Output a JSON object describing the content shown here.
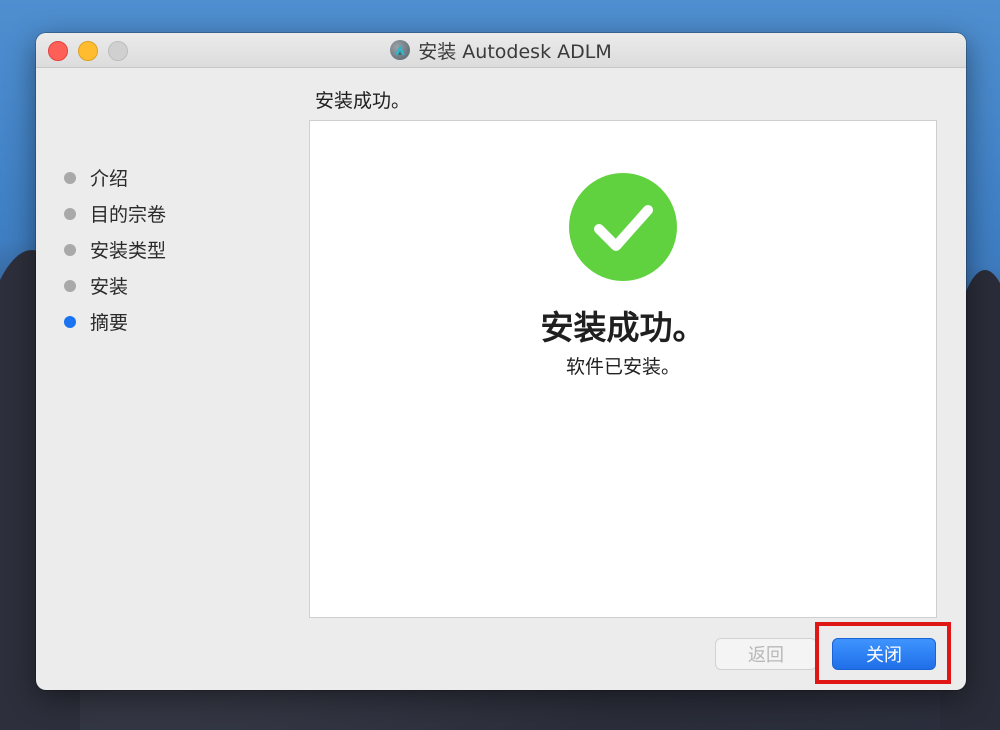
{
  "window": {
    "title": "安装 Autodesk ADLM",
    "app_icon": "autodesk-icon"
  },
  "sidebar": {
    "steps": [
      {
        "label": "介绍",
        "active": false
      },
      {
        "label": "目的宗卷",
        "active": false
      },
      {
        "label": "安装类型",
        "active": false
      },
      {
        "label": "安装",
        "active": false
      },
      {
        "label": "摘要",
        "active": true
      }
    ]
  },
  "main": {
    "heading": "安装成功。",
    "success_title": "安装成功。",
    "success_subtitle": "软件已安装。",
    "status_icon": "checkmark-icon"
  },
  "buttons": {
    "back_label": "返回",
    "back_enabled": false,
    "close_label": "关闭"
  },
  "colors": {
    "accent": "#1a73f0",
    "success": "#61d23f",
    "highlight": "#e01616"
  }
}
